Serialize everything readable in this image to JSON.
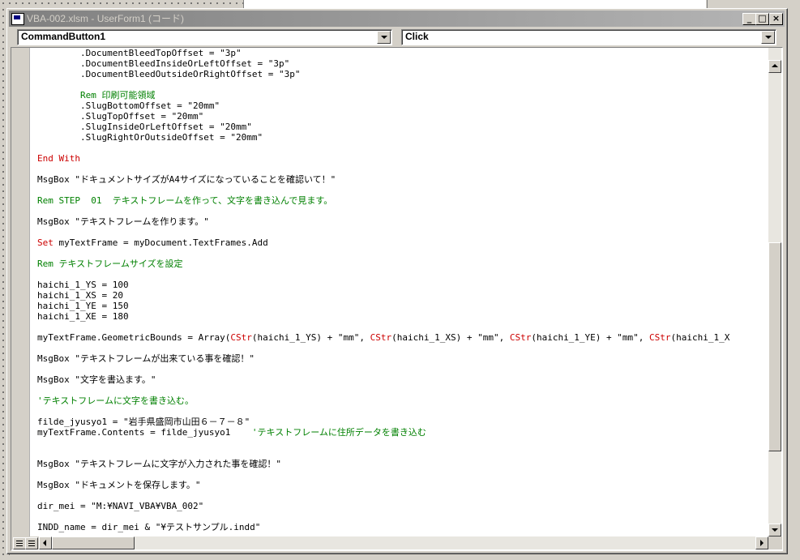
{
  "window": {
    "title": "VBA-002.xlsm - UserForm1 (コード)"
  },
  "title_buttons": {
    "minimize": "_",
    "maximize": "□",
    "close": "×"
  },
  "object_combo": {
    "value": "CommandButton1"
  },
  "procedure_combo": {
    "value": "Click"
  },
  "code_lines": [
    {
      "segs": [
        {
          "t": "        .DocumentBleedTopOffset = \"3p\"",
          "c": ""
        }
      ]
    },
    {
      "segs": [
        {
          "t": "        .DocumentBleedInsideOrLeftOffset = \"3p\"",
          "c": ""
        }
      ]
    },
    {
      "segs": [
        {
          "t": "        .DocumentBleedOutsideOrRightOffset = \"3p\"",
          "c": ""
        }
      ]
    },
    {
      "segs": [
        {
          "t": "",
          "c": ""
        }
      ]
    },
    {
      "segs": [
        {
          "t": "        Rem 印刷可能領域",
          "c": "cm"
        }
      ]
    },
    {
      "segs": [
        {
          "t": "        .SlugBottomOffset = \"20mm\"",
          "c": ""
        }
      ]
    },
    {
      "segs": [
        {
          "t": "        .SlugTopOffset = \"20mm\"",
          "c": ""
        }
      ]
    },
    {
      "segs": [
        {
          "t": "        .SlugInsideOrLeftOffset = \"20mm\"",
          "c": ""
        }
      ]
    },
    {
      "segs": [
        {
          "t": "        .SlugRightOrOutsideOffset = \"20mm\"",
          "c": ""
        }
      ]
    },
    {
      "segs": [
        {
          "t": "",
          "c": ""
        }
      ]
    },
    {
      "segs": [
        {
          "t": "End With",
          "c": "kw"
        }
      ]
    },
    {
      "segs": [
        {
          "t": "",
          "c": ""
        }
      ]
    },
    {
      "segs": [
        {
          "t": "MsgBox \"ドキュメントサイズがA4サイズになっていることを確認いて！\"",
          "c": ""
        }
      ]
    },
    {
      "segs": [
        {
          "t": "",
          "c": ""
        }
      ]
    },
    {
      "segs": [
        {
          "t": "Rem STEP  01  テキストフレームを作って、文字を書き込んで見ます。",
          "c": "cm"
        }
      ]
    },
    {
      "segs": [
        {
          "t": "",
          "c": ""
        }
      ]
    },
    {
      "segs": [
        {
          "t": "MsgBox \"テキストフレームを作ります。\"",
          "c": ""
        }
      ]
    },
    {
      "segs": [
        {
          "t": "",
          "c": ""
        }
      ]
    },
    {
      "segs": [
        {
          "t": "Set",
          "c": "kw"
        },
        {
          "t": " myTextFrame = myDocument.TextFrames.Add",
          "c": ""
        }
      ]
    },
    {
      "segs": [
        {
          "t": "",
          "c": ""
        }
      ]
    },
    {
      "segs": [
        {
          "t": "Rem テキストフレームサイズを設定",
          "c": "cm"
        }
      ]
    },
    {
      "segs": [
        {
          "t": "",
          "c": ""
        }
      ]
    },
    {
      "segs": [
        {
          "t": "haichi_1_YS = 100",
          "c": ""
        }
      ]
    },
    {
      "segs": [
        {
          "t": "haichi_1_XS = 20",
          "c": ""
        }
      ]
    },
    {
      "segs": [
        {
          "t": "haichi_1_YE = 150",
          "c": ""
        }
      ]
    },
    {
      "segs": [
        {
          "t": "haichi_1_XE = 180",
          "c": ""
        }
      ]
    },
    {
      "segs": [
        {
          "t": "",
          "c": ""
        }
      ]
    },
    {
      "segs": [
        {
          "t": "myTextFrame.GeometricBounds = Array(",
          "c": ""
        },
        {
          "t": "CStr",
          "c": "kw"
        },
        {
          "t": "(haichi_1_YS) + \"mm\", ",
          "c": ""
        },
        {
          "t": "CStr",
          "c": "kw"
        },
        {
          "t": "(haichi_1_XS) + \"mm\", ",
          "c": ""
        },
        {
          "t": "CStr",
          "c": "kw"
        },
        {
          "t": "(haichi_1_YE) + \"mm\", ",
          "c": ""
        },
        {
          "t": "CStr",
          "c": "kw"
        },
        {
          "t": "(haichi_1_X",
          "c": ""
        }
      ]
    },
    {
      "segs": [
        {
          "t": "",
          "c": ""
        }
      ]
    },
    {
      "segs": [
        {
          "t": "MsgBox \"テキストフレームが出来ている事を確認！\"",
          "c": ""
        }
      ]
    },
    {
      "segs": [
        {
          "t": "",
          "c": ""
        }
      ]
    },
    {
      "segs": [
        {
          "t": "MsgBox \"文字を書込ます。\"",
          "c": ""
        }
      ]
    },
    {
      "segs": [
        {
          "t": "",
          "c": ""
        }
      ]
    },
    {
      "segs": [
        {
          "t": "'テキストフレームに文字を書き込む。",
          "c": "cm"
        }
      ]
    },
    {
      "segs": [
        {
          "t": "",
          "c": ""
        }
      ]
    },
    {
      "segs": [
        {
          "t": "filde_jyusyo1 = \"岩手県盛岡市山田６－７－８\"",
          "c": ""
        }
      ]
    },
    {
      "segs": [
        {
          "t": "myTextFrame.Contents = filde_jyusyo1    ",
          "c": ""
        },
        {
          "t": "'テキストフレームに住所データを書き込む",
          "c": "cm"
        }
      ]
    },
    {
      "segs": [
        {
          "t": "",
          "c": ""
        }
      ]
    },
    {
      "segs": [
        {
          "t": "",
          "c": ""
        }
      ]
    },
    {
      "segs": [
        {
          "t": "MsgBox \"テキストフレームに文字が入力された事を確認！\"",
          "c": ""
        }
      ]
    },
    {
      "segs": [
        {
          "t": "",
          "c": ""
        }
      ]
    },
    {
      "segs": [
        {
          "t": "MsgBox \"ドキュメントを保存します。\"",
          "c": ""
        }
      ]
    },
    {
      "segs": [
        {
          "t": "",
          "c": ""
        }
      ]
    },
    {
      "segs": [
        {
          "t": "dir_mei = \"M:¥NAVI_VBA¥VBA_002\"",
          "c": ""
        }
      ]
    },
    {
      "segs": [
        {
          "t": "",
          "c": ""
        }
      ]
    },
    {
      "segs": [
        {
          "t": "INDD_name = dir_mei & \"¥テストサンプル.indd\"",
          "c": ""
        }
      ]
    }
  ],
  "colors": {
    "keyword": "#cc0000",
    "comment": "#008000",
    "text": "#000000"
  }
}
